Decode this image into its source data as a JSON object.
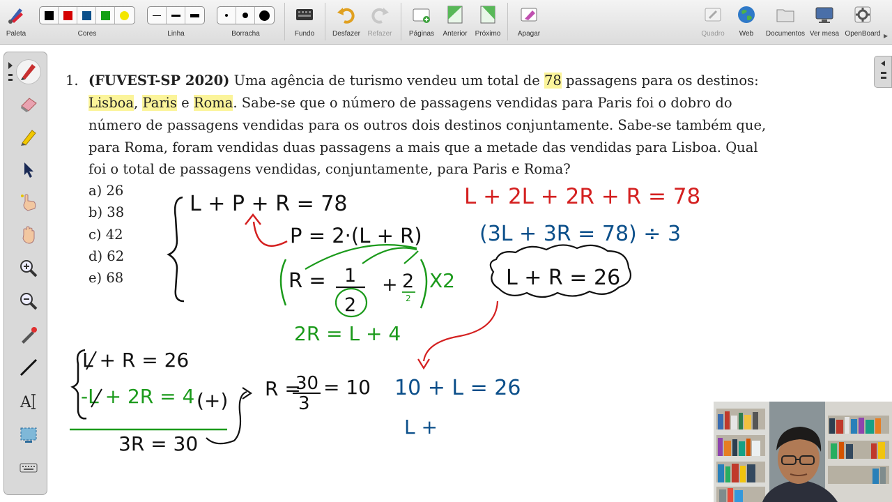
{
  "toolbar": {
    "paleta": "Paleta",
    "cores": "Cores",
    "linha": "Linha",
    "borracha": "Borracha",
    "fundo": "Fundo",
    "desfazer": "Desfazer",
    "refazer": "Refazer",
    "paginas": "Páginas",
    "anterior": "Anterior",
    "proximo": "Próximo",
    "apagar": "Apagar",
    "quadro": "Quadro",
    "web": "Web",
    "documentos": "Documentos",
    "ver_mesa": "Ver mesa",
    "openboard": "OpenBoard",
    "colors": [
      "#000000",
      "#d40000",
      "#0b4f8a",
      "#14a014",
      "#f3e600"
    ]
  },
  "question": {
    "number": "1.",
    "source": "(FUVEST-SP 2020)",
    "line1_a": "Uma agência de turismo vendeu um total de",
    "line1_total": "78",
    "line1_b": "passagens para os destinos:",
    "dest1": "Lisboa",
    "comma": ",",
    "dest2": "Paris",
    "and": "e",
    "dest3": "Roma",
    "line2_b": ". Sabe-se que o número de passagens vendidas para Paris foi o dobro do",
    "line3": "número de passagens vendidas para os outros dois destinos conjuntamente. Sabe-se também que,",
    "line4": "para Roma, foram vendidas duas passagens a mais que a metade das vendidas para Lisboa. Qual",
    "line5": "foi o total de passagens vendidas, conjuntamente, para Paris e Roma?",
    "options": [
      "a) 26",
      "b) 38",
      "c) 42",
      "d) 62",
      "e) 68"
    ]
  },
  "handwriting": {
    "sys1_eq1": "L + P + R = 78",
    "sys1_eq2": "P = 2·(L + R)",
    "sys1_eq3_r": "R =",
    "sys1_frac_num": "1",
    "sys1_frac_den": "2",
    "sys1_plus": "+",
    "sys1_two": "2",
    "sys1_two_small": "2",
    "sys1_x2": "X2",
    "sys1_result": "2R = L + 4",
    "red_eq": "L + 2L + 2R + R = 78",
    "blue_eq": "(3L + 3R = 78) ÷ 3",
    "cloud_eq": "L + R = 26",
    "sys2_eq1": "L + R = 26",
    "sys2_eq2": "-L + 2R = 4",
    "sys2_plus": "(+)",
    "sys2_sum": "3R = 30",
    "r_prefix": "R =",
    "r_num": "30",
    "r_den": "3",
    "r_value": "= 10",
    "sub_eq": "10 + L = 26",
    "partial": "L +"
  }
}
